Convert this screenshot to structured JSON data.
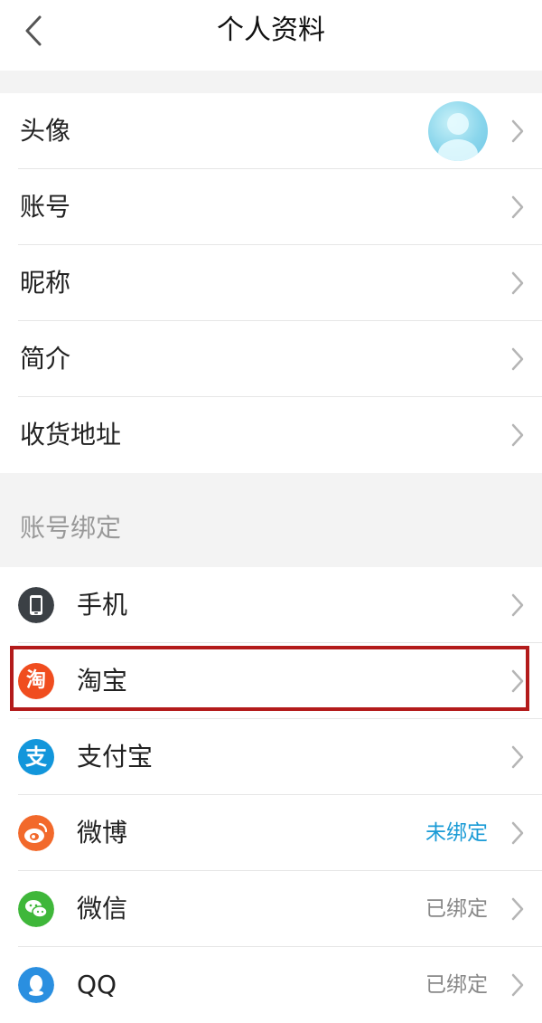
{
  "header": {
    "title": "个人资料",
    "back_icon": "chevron-left-icon"
  },
  "profile": {
    "items": [
      {
        "label": "头像"
      },
      {
        "label": "账号"
      },
      {
        "label": "昵称"
      },
      {
        "label": "简介"
      },
      {
        "label": "收货地址"
      }
    ]
  },
  "binding": {
    "title": "账号绑定",
    "items": [
      {
        "label": "手机",
        "status": "",
        "icon": "phone-icon",
        "color": "#3b4045"
      },
      {
        "label": "淘宝",
        "status": "",
        "icon": "taobao-icon",
        "color": "#f04d1f",
        "icon_text": "淘"
      },
      {
        "label": "支付宝",
        "status": "",
        "icon": "alipay-icon",
        "color": "#1296db",
        "icon_text": "支"
      },
      {
        "label": "微博",
        "status": "未绑定",
        "icon": "weibo-icon",
        "color": "#f2692b"
      },
      {
        "label": "微信",
        "status": "已绑定",
        "icon": "wechat-icon",
        "color": "#3fb73a"
      },
      {
        "label": "QQ",
        "status": "已绑定",
        "icon": "qq-icon",
        "color": "#2a8fe0"
      }
    ]
  },
  "colors": {
    "unbound_status": "#1a9bd6",
    "bound_status": "#888888",
    "highlight_border": "#b31b1b"
  }
}
